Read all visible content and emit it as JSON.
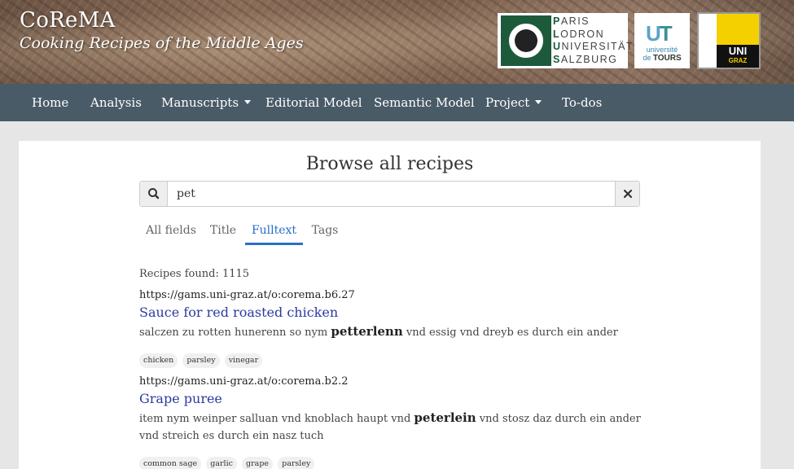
{
  "site": {
    "title": "CoReMA",
    "subtitle": "Cooking Recipes of the Middle Ages"
  },
  "logos": {
    "plus": {
      "line1": "ARIS",
      "line2": "ODRON",
      "line3": "NIVERSITÄT",
      "line4": "ALZBURG",
      "l1": "P",
      "l2": "L",
      "l3": "U",
      "l4": "S"
    },
    "tours": {
      "small": "université",
      "prefix": "de ",
      "big": "TOURS"
    },
    "graz": {
      "uni": "UNI",
      "graz": "GRAZ"
    }
  },
  "nav": {
    "items": [
      {
        "label": "Home"
      },
      {
        "label": "Analysis"
      },
      {
        "label": "Manuscripts"
      },
      {
        "label": "Editorial Model"
      },
      {
        "label": "Semantic Model"
      },
      {
        "label": "Project"
      },
      {
        "label": "To-dos"
      }
    ]
  },
  "main": {
    "title": "Browse all recipes",
    "search": {
      "value": "pet",
      "placeholder": ""
    },
    "tabs": [
      {
        "label": "All fields"
      },
      {
        "label": "Title"
      },
      {
        "label": "Fulltext"
      },
      {
        "label": "Tags"
      }
    ],
    "found_label": "Recipes found: 1115"
  },
  "results": [
    {
      "id": "https://gams.uni-graz.at/o:corema.b6.27",
      "title": "Sauce for red roasted chicken",
      "snippet_before": "salczen zu rotten hunerenn so nym ",
      "highlight": "petterlenn",
      "snippet_after": " vnd essig vnd dreyb es durch ein ander",
      "tags": [
        "chicken",
        "parsley",
        "vinegar"
      ]
    },
    {
      "id": "https://gams.uni-graz.at/o:corema.b2.2",
      "title": "Grape puree",
      "snippet_before": "item nym weinper salluan vnd knoblach haupt vnd ",
      "highlight": "peterlein",
      "snippet_after": " vnd stosz daz durch ein ander vnd streich es durch ein nasz tuch",
      "tags": [
        "common sage",
        "garlic",
        "grape",
        "parsley"
      ]
    }
  ],
  "colors": {
    "navbar": "#495b67",
    "accent": "#2a6fc9",
    "link": "#2b3aa0"
  }
}
